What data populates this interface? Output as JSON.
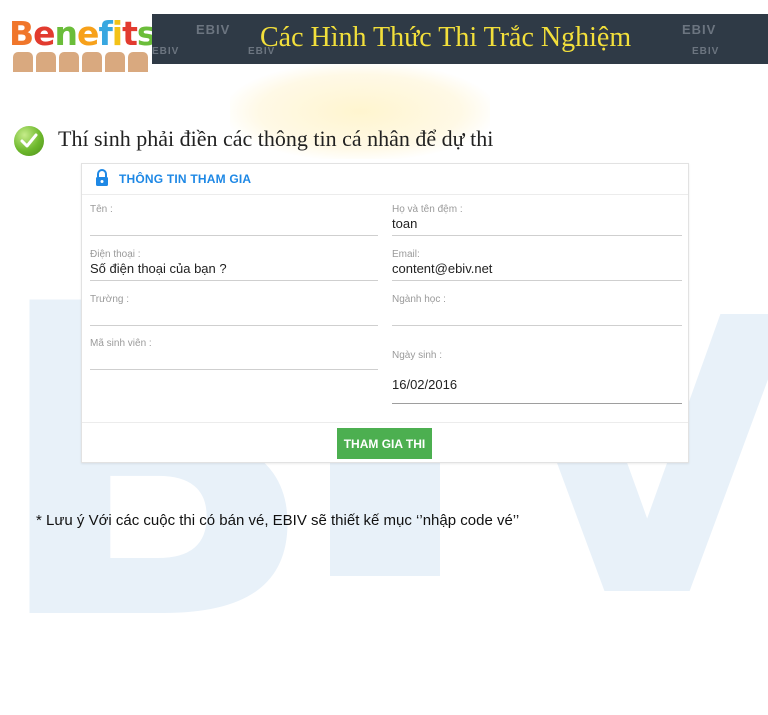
{
  "colors": {
    "banner_bg": "#2f3a46",
    "banner_title": "#f2df3b",
    "accent_blue": "#1e88e5",
    "button_green": "#4caf50"
  },
  "logo": {
    "text": "Benefits",
    "letter_colors": [
      "#f0762b",
      "#e23b2f",
      "#6bbd3a",
      "#f7a11a",
      "#38a7e0",
      "#f3c218",
      "#e23b2f",
      "#6bbd3a"
    ]
  },
  "banner": {
    "title": "Các Hình Thức Thi Trắc Nghiệm",
    "watermark": "EBIV"
  },
  "heading": {
    "icon": "check-circle-icon",
    "text": "Thí sinh phải điền các thông tin cá nhân để dự thi"
  },
  "form": {
    "icon": "lock-icon",
    "title": "THÔNG TIN THAM GIA",
    "fields": {
      "ten": {
        "label": "Tên :",
        "value": ""
      },
      "ho_ten_dem": {
        "label": "Họ và tên đệm :",
        "value": "toan"
      },
      "dien_thoai": {
        "label": "Điện thoại :",
        "value": "Số điện thoại của bạn ?"
      },
      "email": {
        "label": "Email:",
        "value": "content@ebiv.net"
      },
      "truong": {
        "label": "Trường :",
        "value": ""
      },
      "nganh_hoc": {
        "label": "Ngành học :",
        "value": ""
      },
      "ma_sinh_vien": {
        "label": "Mã sinh viên :",
        "value": ""
      },
      "ngay_sinh": {
        "label": "Ngày sinh :",
        "value": "16/02/2016"
      }
    },
    "submit_label": "THAM GIA THI"
  },
  "note": "* Lưu ý Với các cuộc thi có bán vé, EBIV sẽ thiết kế mục ‘’nhập code vé’’"
}
